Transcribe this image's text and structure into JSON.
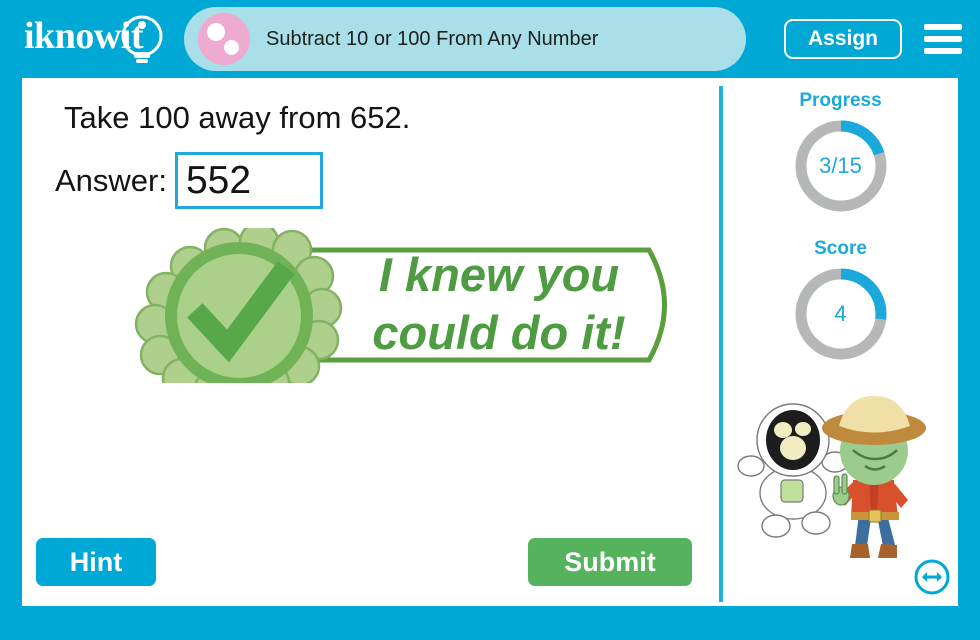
{
  "brand": {
    "logo_text": "iknowit",
    "logo_icon": "lightbulb-icon"
  },
  "header": {
    "lesson_title": "Subtract 10 or 100 From Any Number",
    "lesson_icon": "pink-dots-icon",
    "assign_label": "Assign",
    "menu_icon": "hamburger-menu-icon"
  },
  "main": {
    "question": "Take 100 away from 652.",
    "answer_label": "Answer:",
    "answer_value": "552",
    "answer_placeholder": "",
    "feedback": {
      "message": "I knew you\ncould do it!",
      "badge_icon": "green-rosette-check-icon",
      "state": "correct"
    },
    "hint_label": "Hint",
    "submit_label": "Submit"
  },
  "sidebar": {
    "progress": {
      "label": "Progress",
      "value": "3/15",
      "current": 3,
      "total": 15,
      "percent": 20
    },
    "score": {
      "label": "Score",
      "value": "4",
      "current": 4,
      "percent": 27
    },
    "illustration_icon": "astronaut-and-cowboy-alien-icon",
    "resize_icon": "horizontal-resize-arrow-icon"
  },
  "colors": {
    "brand_blue": "#00a8d5",
    "accent_blue": "#1ba9dc",
    "pill_blue": "#a8dfe8",
    "pink": "#eeaad0",
    "green": "#54b35c",
    "feedback_green": "#4e9b42",
    "gauge_track": "#b6b8b8"
  }
}
